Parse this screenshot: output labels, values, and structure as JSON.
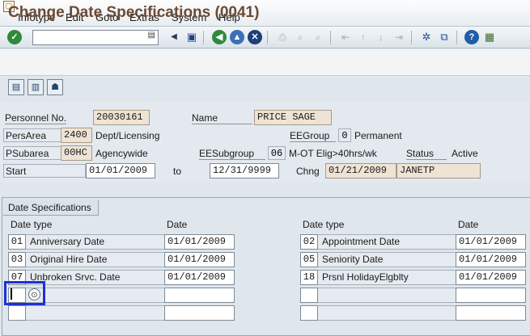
{
  "menu": [
    "Infotype",
    "Edit",
    "Goto",
    "Extras",
    "System",
    "Help"
  ],
  "toolbar": {
    "command_value": "",
    "icons": [
      "enter-icon",
      "back-icon",
      "save-icon",
      "nav-back-icon",
      "exit-icon",
      "cancel-icon",
      "print-icon",
      "find-icon",
      "find-next-icon",
      "first-page-icon",
      "prev-page-icon",
      "next-page-icon",
      "last-page-icon",
      "new-session-icon",
      "shortcut-icon",
      "help-icon",
      "customize-icon"
    ]
  },
  "title": "Change Date Specifications (0041)",
  "header": {
    "personnel_no_label": "Personnel No.",
    "personnel_no": "20030161",
    "name_label": "Name",
    "name": "PRICE SAGE",
    "persarea_label": "PersArea",
    "persarea": "2400",
    "persarea_text": "Dept/Licensing",
    "eegroup_label": "EEGroup",
    "eegroup": "0",
    "eegroup_text": "Permanent",
    "psubarea_label": "PSubarea",
    "psubarea": "00HC",
    "psubarea_text": "Agencywide",
    "eesubgroup_label": "EESubgroup",
    "eesubgroup": "06",
    "eesubgroup_text": "M-OT Elig>40hrs/wk",
    "status_label": "Status",
    "status": "Active",
    "start_label": "Start",
    "start": "01/01/2009",
    "to_label": "to",
    "end": "12/31/9999",
    "chng_label": "Chng",
    "chng_date": "01/21/2009",
    "chng_user": "JANETP"
  },
  "date_spec": {
    "group_title": "Date Specifications",
    "col_type": "Date type",
    "col_date": "Date",
    "left": [
      {
        "code": "01",
        "label": "Anniversary Date",
        "date": "01/01/2009"
      },
      {
        "code": "03",
        "label": "Original Hire Date",
        "date": "01/01/2009"
      },
      {
        "code": "07",
        "label": "Unbroken Srvc. Date",
        "date": "01/01/2009"
      },
      {
        "code": "",
        "label": "",
        "date": ""
      },
      {
        "code": "",
        "label": "",
        "date": ""
      }
    ],
    "right": [
      {
        "code": "02",
        "label": "Appointment Date",
        "date": "01/01/2009"
      },
      {
        "code": "05",
        "label": "Seniority Date",
        "date": "01/01/2009"
      },
      {
        "code": "18",
        "label": "Prsnl HolidayElgblty",
        "date": "01/01/2009"
      },
      {
        "code": "",
        "label": "",
        "date": ""
      },
      {
        "code": "",
        "label": "",
        "date": ""
      }
    ]
  },
  "colors": {
    "title": "#6d4a33",
    "focus_border": "#1e2fd6",
    "readonly_field": "#efe3d4"
  }
}
